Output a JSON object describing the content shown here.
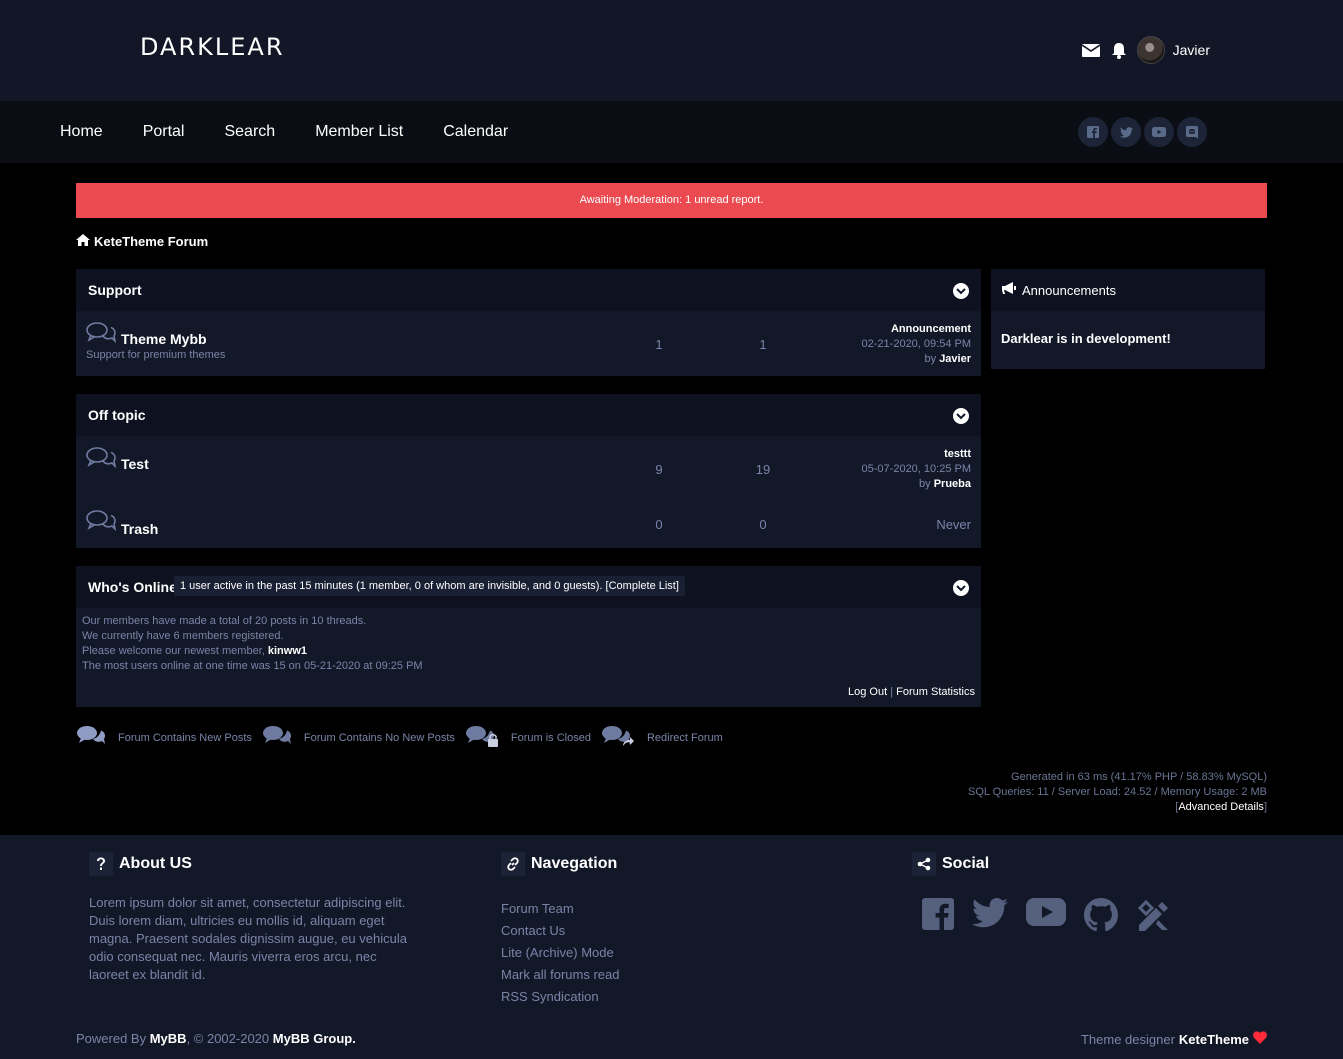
{
  "header": {
    "logo": "DARKLEAR",
    "username": "Javier"
  },
  "nav": {
    "items": [
      "Home",
      "Portal",
      "Search",
      "Member List",
      "Calendar"
    ]
  },
  "social_nav": [
    "facebook-icon",
    "twitter-icon",
    "youtube-icon",
    "discord-icon"
  ],
  "alert": "Awaiting Moderation: 1 unread report.",
  "breadcrumb": "KeteTheme Forum",
  "categories": [
    {
      "title": "Support",
      "forums": [
        {
          "name": "Theme Mybb",
          "desc": "Support for premium themes",
          "threads": "1",
          "posts": "1",
          "last_title": "Announcement",
          "last_date": "02-21-2020, 09:54 PM",
          "last_by_label": "by",
          "last_by": "Javier"
        }
      ]
    },
    {
      "title": "Off topic",
      "forums": [
        {
          "name": "Test",
          "desc": "",
          "threads": "9",
          "posts": "19",
          "last_title": "testtt",
          "last_date": "05-07-2020, 10:25 PM",
          "last_by_label": "by",
          "last_by": "Prueba"
        },
        {
          "name": "Trash",
          "desc": "",
          "threads": "0",
          "posts": "0",
          "last_never": "Never"
        }
      ]
    }
  ],
  "announcements": {
    "title": "Announcements",
    "body": "Darklear is in development!"
  },
  "whos_online": {
    "title": "Who's Online",
    "active": "1 user active in the past 15 minutes (1 member, 0 of whom are invisible, and 0 guests). [Complete List]",
    "line1": "Our members have made a total of 20 posts in 10 threads.",
    "line2": "We currently have 6 members registered.",
    "line3_prefix": "Please welcome our newest member,",
    "newest_member": "kinww1",
    "line4": "The most users online at one time was 15 on 05-21-2020 at 09:25 PM",
    "logout": "Log Out",
    "sep": "|",
    "stats": "Forum Statistics"
  },
  "legend": [
    "Forum Contains New Posts",
    "Forum Contains No New Posts",
    "Forum is Closed",
    "Redirect Forum"
  ],
  "debug": {
    "line1": "Generated in 63 ms (41.17% PHP / 58.83% MySQL)",
    "line2": "SQL Queries: 11 / Server Load: 24.52 / Memory Usage: 2 MB",
    "open": "[",
    "advanced": "Advanced Details",
    "close": "]"
  },
  "footer": {
    "about_title": "About US",
    "about_text": "Lorem ipsum dolor sit amet, consectetur adipiscing elit. Duis lorem diam, ultricies eu mollis id, aliquam eget magna. Praesent sodales dignissim augue, eu vehicula odio consequat nec. Mauris viverra eros arcu, nec laoreet ex blandit id.",
    "nav_title": "Navegation",
    "nav_links": [
      "Forum Team",
      "Contact Us",
      "Lite (Archive) Mode",
      "Mark all forums read",
      "RSS Syndication"
    ],
    "social_title": "Social",
    "powered_prefix": "Powered By",
    "mybb": "MyBB",
    "copy_mid": ", © 2002-2020",
    "mybb_group": "MyBB Group.",
    "designer_prefix": "Theme designer",
    "designer": "KeteTheme"
  },
  "colors": {
    "header_bg": "#121626",
    "alert": "#ea4a50",
    "panel": "#131828",
    "muted": "#7a84a8",
    "heart": "#ff2b3a"
  }
}
